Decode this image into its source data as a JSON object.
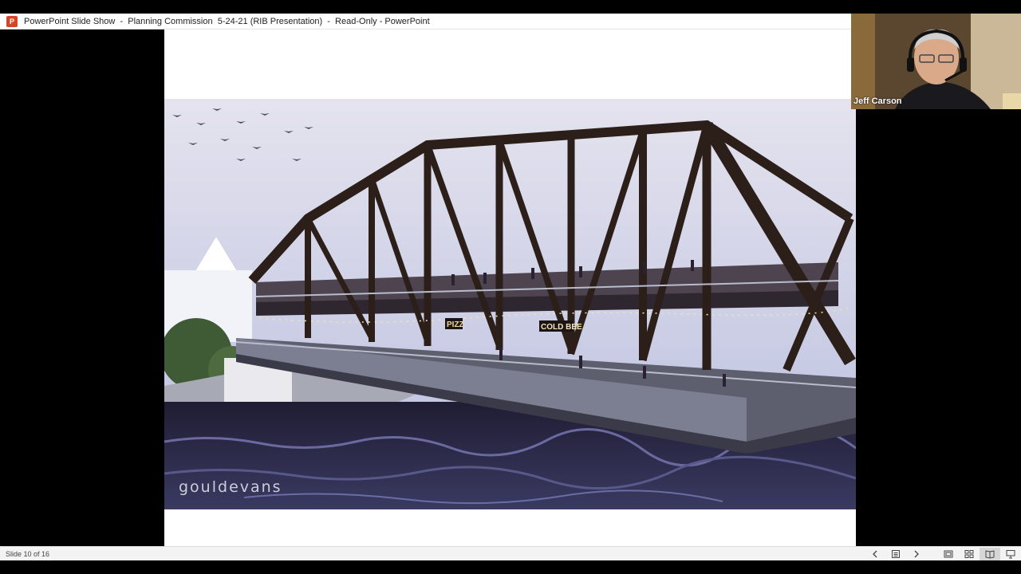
{
  "window": {
    "app_icon_letter": "P",
    "title": "PowerPoint Slide Show  -  Planning Commission  5-24-21 (RIB Presentation)  -  Read-Only - PowerPoint"
  },
  "slide": {
    "watermark": "gouldevans",
    "signs": {
      "pizza": "PIZZ",
      "cold_beer": "COLD BEE"
    }
  },
  "video": {
    "participant_name": "Jeff Carson"
  },
  "statusbar": {
    "slide_counter": "Slide 10 of 16",
    "icons": [
      "chevron-left-icon",
      "slide-menu-icon",
      "chevron-right-icon",
      "normal-view-icon",
      "slide-sorter-icon",
      "reading-view-icon",
      "slide-show-icon"
    ],
    "active_view": "reading-view-icon"
  },
  "colors": {
    "powerpoint_brand": "#d24726",
    "sky": "#c9cde6",
    "bridge": "#2c1f1a",
    "water": "#2a2a4a"
  }
}
